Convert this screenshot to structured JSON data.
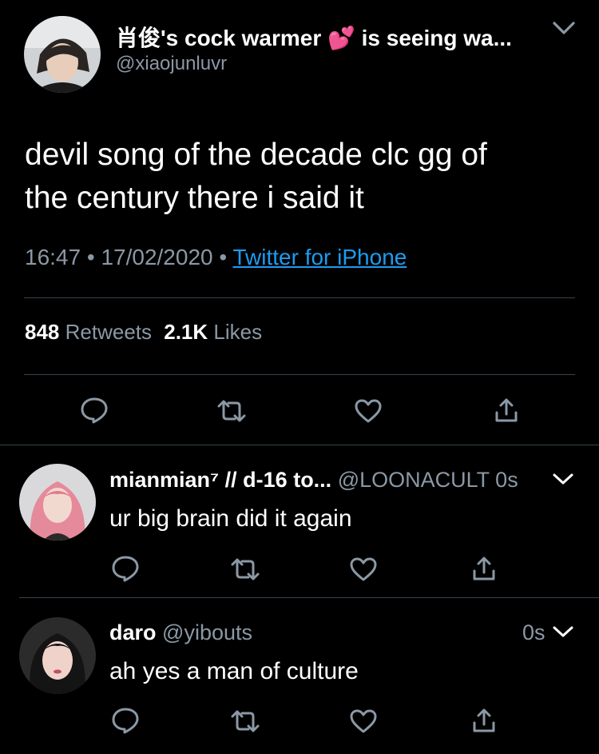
{
  "main_tweet": {
    "display_name": "肖俊's cock warmer 💕 is seeing wa...",
    "handle": "@xiaojunluvr",
    "text_line1": "devil song of the decade clc gg of",
    "text_line2": "the century there i said it",
    "time": "16:47",
    "date": "17/02/2020",
    "source": "Twitter for iPhone",
    "separator": "•",
    "retweets_count": "848",
    "retweets_label": "Retweets",
    "likes_count": "2.1K",
    "likes_label": "Likes"
  },
  "replies": [
    {
      "display_name": "mianmian⁷ // d-16 to...",
      "handle": "@LOONACULT",
      "time": "0s",
      "text": "ur big brain did it again"
    },
    {
      "display_name": "daro",
      "handle": "@yibouts",
      "time": "0s",
      "text": "ah yes a man of culture"
    }
  ],
  "icons": {
    "reply": "reply-icon",
    "retweet": "retweet-icon",
    "like": "heart-icon",
    "share": "share-icon",
    "more": "chevron-down-icon"
  },
  "colors": {
    "background": "#000000",
    "text": "#ffffff",
    "muted": "#8b98a5",
    "link": "#1d9bf0",
    "divider": "#38444d"
  }
}
